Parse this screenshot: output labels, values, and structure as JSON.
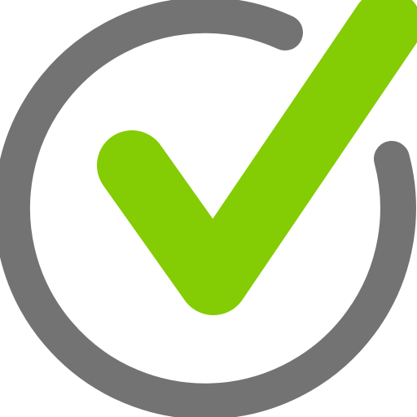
{
  "icon": {
    "name": "check-circle-icon",
    "colors": {
      "ring": "#737373",
      "check": "#84cc04",
      "background": "#ffffff"
    }
  }
}
